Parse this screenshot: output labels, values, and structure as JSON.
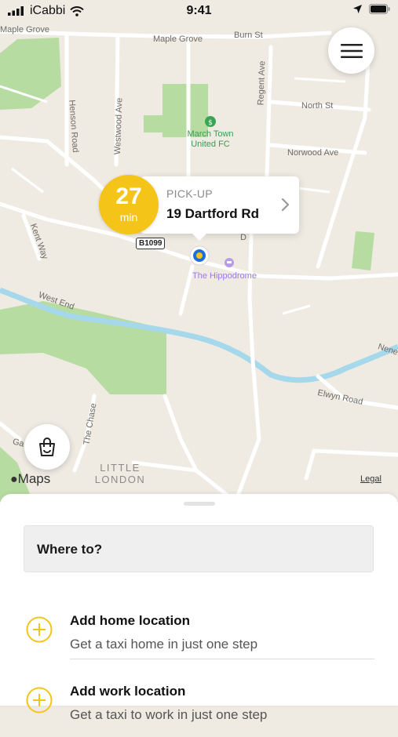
{
  "status_bar": {
    "carrier": "iCabbi",
    "time": "9:41"
  },
  "map": {
    "streets": [
      "Maple Grove",
      "Burn St",
      "Regent Ave",
      "North St",
      "Norwood Ave",
      "Henson Road",
      "Westwood Ave",
      "Kent Way",
      "West End",
      "The Chase",
      "Elwyn Road",
      "Nene",
      "Ga",
      "B1099",
      "D"
    ],
    "places": {
      "football_ground": "March Town United FC",
      "venue": "The Hippodrome",
      "area": "LITTLE LONDON"
    },
    "attribution": "Maps",
    "legal": "Legal"
  },
  "pickup": {
    "eta_value": "27",
    "eta_unit": "min",
    "label": "PICK-UP",
    "address": "19 Dartford Rd"
  },
  "sheet": {
    "where_to_label": "Where to?",
    "options": [
      {
        "title": "Add home location",
        "subtitle": "Get a taxi home in just one step"
      },
      {
        "title": "Add work location",
        "subtitle": "Get a taxi to work in just one step"
      }
    ]
  },
  "colors": {
    "accent": "#f5c419",
    "map_bg": "#efebe3",
    "park": "#b7dca1",
    "water": "#a6d8ec",
    "road": "#ffffff",
    "pin": "#1e6fd9"
  },
  "icons": [
    "wifi-icon",
    "location-arrow-icon",
    "battery-icon",
    "hamburger-icon",
    "basket-icon",
    "chevron-right-icon",
    "plus-circle-icon",
    "football-icon",
    "hotel-icon",
    "apple-logo-icon"
  ]
}
